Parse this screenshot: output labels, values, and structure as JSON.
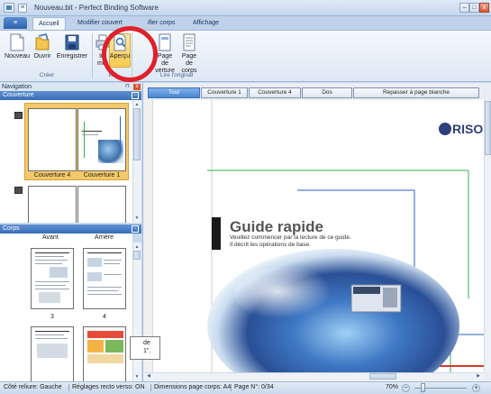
{
  "window": {
    "title": "Nouveau.bit - Perfect Binding Software",
    "minimize": "–",
    "maximize": "□",
    "close": "x"
  },
  "ribbon": {
    "app_menu": "≡",
    "tabs": [
      "Accueil",
      "Modifier couverture",
      "Modifier corps",
      "Affichage"
    ],
    "tab_visible": [
      "Accueil",
      "Modifier couvert",
      "ifier corps",
      "Affichage"
    ],
    "buttons": {
      "nouveau": "Nouveau",
      "ouvrir": "Ouvrir",
      "enregistrer": "Enregistrer",
      "imprimer": "Im    mer",
      "apercu": "Aperçu",
      "page_couv_1": "Page de",
      "page_couv_2": "verture",
      "page_corps_1": "Page de",
      "page_corps_2": "corps"
    },
    "groups": {
      "creer": "Créer",
      "imprimer": "Im",
      "lire_original": "Lire l'original"
    }
  },
  "navigation": {
    "header": "Navigation",
    "pin": "📌",
    "close": "x",
    "couverture_header": "Couverture",
    "couverture_labels": [
      "Couverture 4",
      "Couverture 1"
    ],
    "corps_header": "Corps",
    "corps_columns": [
      "Avant",
      "Arrière"
    ],
    "corps_page_numbers": [
      "3",
      "4"
    ],
    "collapse": "−"
  },
  "preview": {
    "tabs": [
      "Tout",
      "Couverture 1",
      "Couverture 4",
      "Dos",
      "Repasser à page blanche"
    ],
    "active_tab": "Tout",
    "brand": "RISO",
    "doc_title": "Guide rapide",
    "doc_sub_1": "Veuillez commencer par la lecture de ce guide.",
    "doc_sub_2": "Il décrit les opérations de base.",
    "tooltip_fragment_1": "de",
    "tooltip_fragment_2": "1\"."
  },
  "status": {
    "binding_side": "Côté reliure: Gauche",
    "duplex": "Réglages recto verso: ON",
    "page_dims": "Dimensions page corps: A4",
    "page_no": "Page N°: 0/34",
    "zoom": "70%",
    "zoom_minus": "−",
    "zoom_plus": "+",
    "zoom_level_percent": 70
  },
  "colors": {
    "accent": "#3a6eb8",
    "selected_cover": "#f5c96a",
    "highlight_circle": "#e0202a",
    "line_green": "#2fb14a",
    "line_blue": "#2a62c8"
  }
}
